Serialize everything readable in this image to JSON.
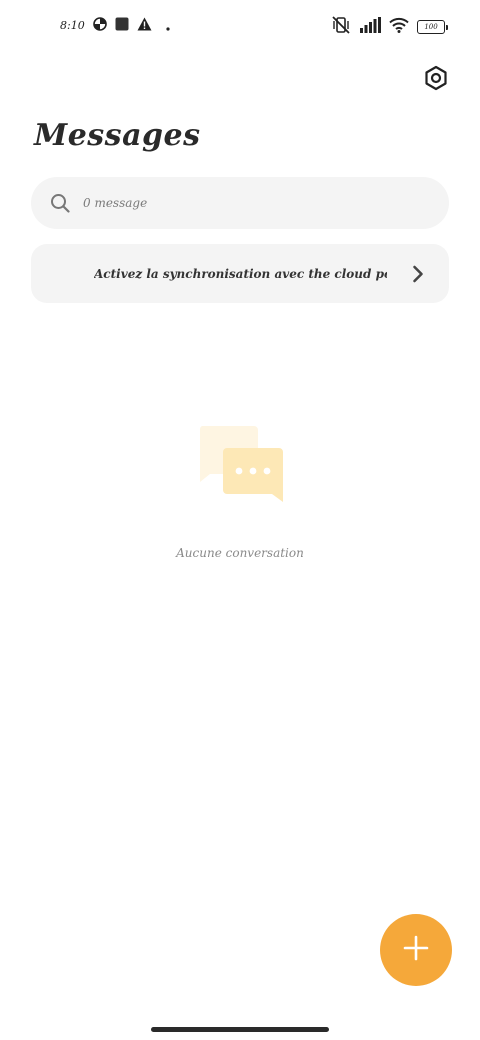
{
  "status_bar": {
    "time": "8:10",
    "battery": "100",
    "left_icons": [
      "data-saver-icon",
      "square-app-icon",
      "warning-icon",
      "dot-icon"
    ],
    "right_icons": [
      "mute-vibrate-icon",
      "signal-icon",
      "wifi-icon",
      "battery-icon"
    ]
  },
  "header": {
    "title": "Messages",
    "settings_icon": "settings-hexagon-icon"
  },
  "search": {
    "placeholder": "0 message",
    "icon": "search-icon"
  },
  "sync_banner": {
    "text": "Activez la synchronisation avec the cloud pour",
    "icon": "chevron-right-icon"
  },
  "empty_state": {
    "icon": "chat-bubbles-icon",
    "text": "Aucune conversation"
  },
  "fab": {
    "icon": "plus-icon"
  },
  "colors": {
    "accent": "#f5a83a",
    "illustration": "#fde8b6",
    "surface": "#f4f4f4"
  }
}
